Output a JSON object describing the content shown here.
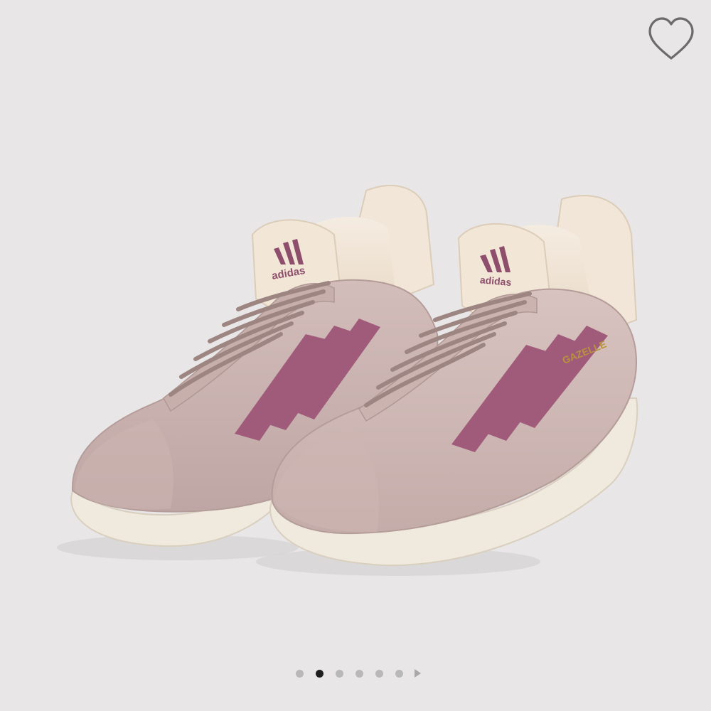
{
  "product": {
    "brand_logo_text": "adidas",
    "side_print_text": "GAZELLE",
    "colors": {
      "background": "#e8e6e7",
      "suede": "#c9b2b0",
      "stripe": "#a15b7a",
      "sole": "#efe9de",
      "lining": "#f1e6d8"
    }
  },
  "wishlist": {
    "icon": "heart-outline-icon",
    "color": "#6b6b6b"
  },
  "pagination": {
    "total": 6,
    "current": 2,
    "next_icon": "play-triangle-icon"
  }
}
